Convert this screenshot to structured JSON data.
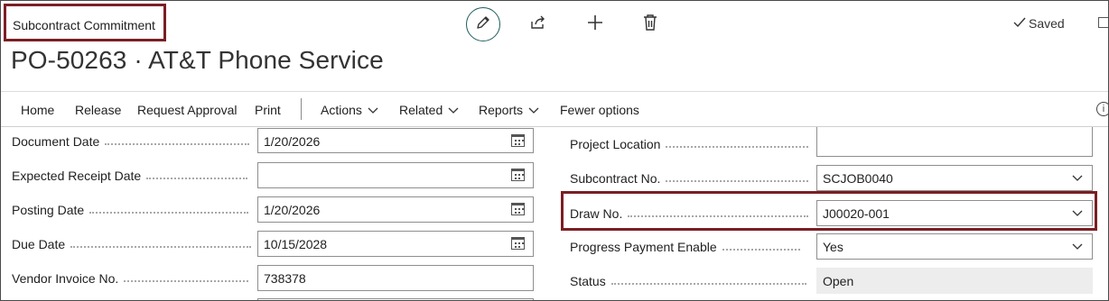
{
  "header": {
    "caption": "Subcontract Commitment",
    "title": "PO-50263 · AT&T Phone Service",
    "saved_label": "Saved",
    "icons": [
      "edit-icon",
      "share-icon",
      "new-icon",
      "delete-icon",
      "checkmark-icon",
      "expand-icon"
    ]
  },
  "actions": {
    "home": "Home",
    "release": "Release",
    "request_approval": "Request Approval",
    "print": "Print",
    "actions": "Actions",
    "related": "Related",
    "reports": "Reports",
    "fewer_options": "Fewer options"
  },
  "left_fields": {
    "document_date": {
      "label": "Document Date",
      "value": "1/20/2026"
    },
    "expected_receipt_date": {
      "label": "Expected Receipt Date",
      "value": ""
    },
    "posting_date": {
      "label": "Posting Date",
      "value": "1/20/2026"
    },
    "due_date": {
      "label": "Due Date",
      "value": "10/15/2028"
    },
    "vendor_invoice_no": {
      "label": "Vendor Invoice No.",
      "value": "738378"
    }
  },
  "right_fields": {
    "project_location": {
      "label": "Project Location",
      "value": ""
    },
    "subcontract_no": {
      "label": "Subcontract No.",
      "value": "SCJOB0040"
    },
    "draw_no": {
      "label": "Draw No.",
      "value": "J00020-001"
    },
    "progress_payment_enable": {
      "label": "Progress Payment Enable",
      "value": "Yes"
    },
    "status": {
      "label": "Status",
      "value": "Open"
    }
  },
  "colors": {
    "highlight": "#7a1f24",
    "edit_ring": "#1f5d5d"
  }
}
